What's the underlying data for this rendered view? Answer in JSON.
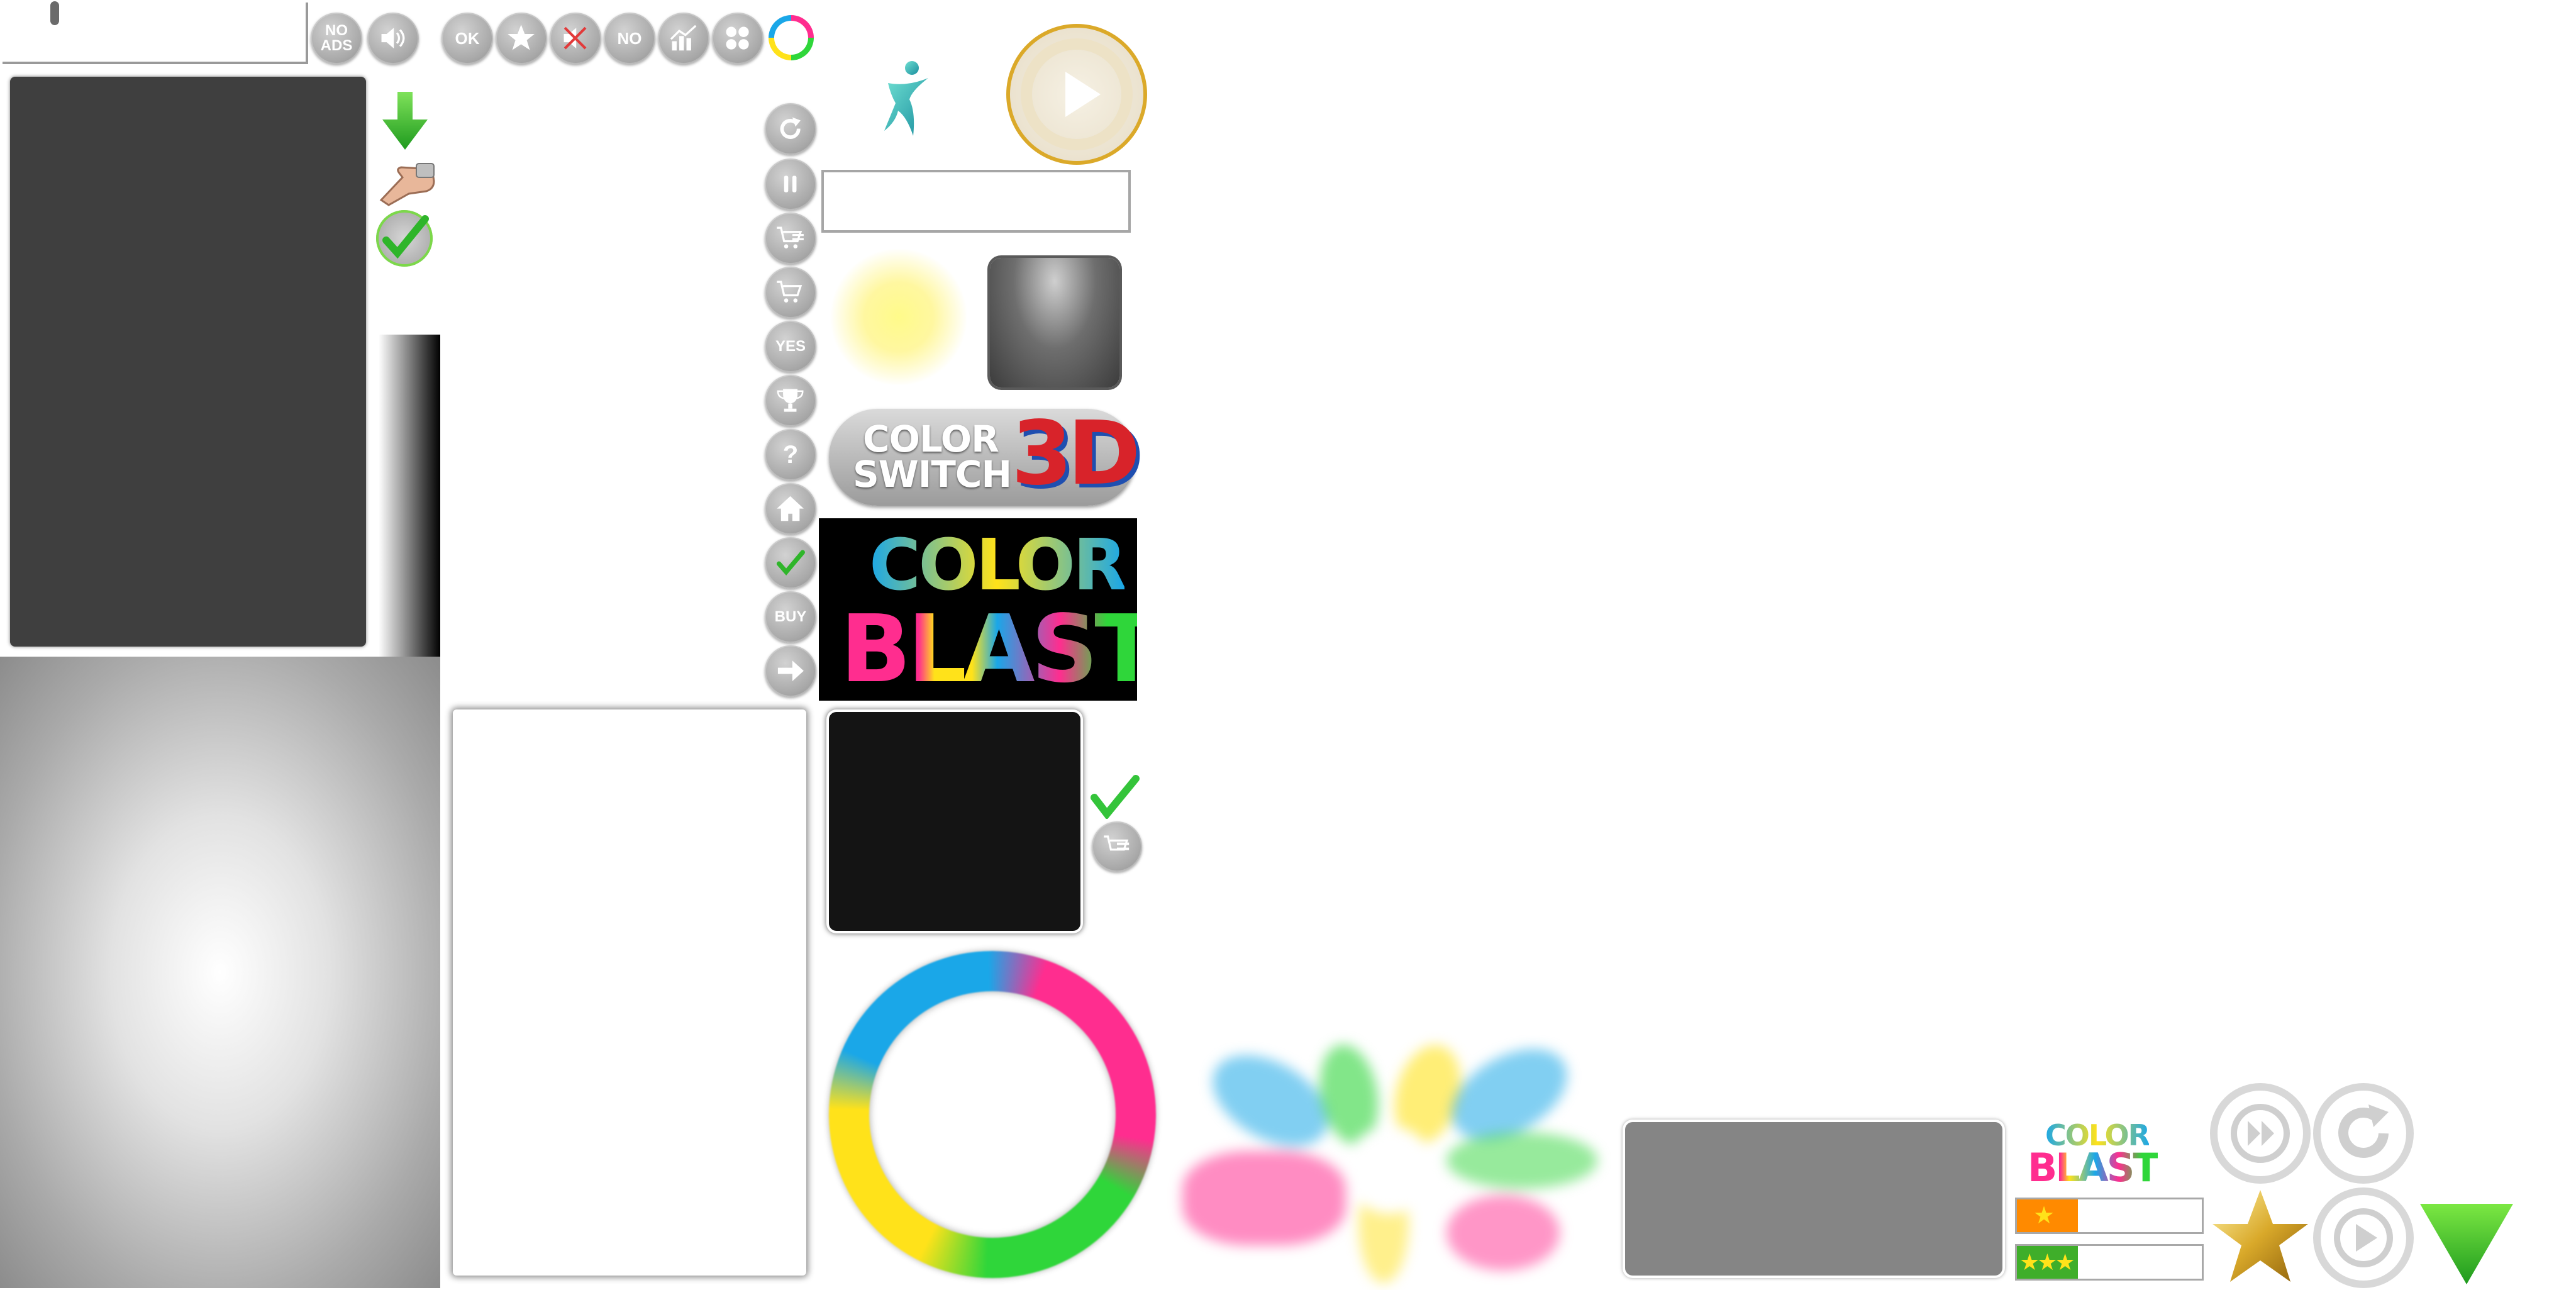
{
  "buttons": {
    "no_ads": "NO\nADS",
    "ok": "OK",
    "no": "NO",
    "yes": "YES",
    "buy": "BUY",
    "help": "?"
  },
  "logos": {
    "switch_line1": "COLOR",
    "switch_line2": "SWITCH",
    "switch_3d": "3D",
    "blast_word1": "COLOR",
    "blast_word2": "BLAST",
    "small_word1": "COLOR",
    "small_word2": "BLAST"
  },
  "colors": {
    "cyan": "#1aa7e8",
    "magenta": "#ff2d8f",
    "yellow": "#ffe21a",
    "green": "#2fd63a",
    "gold": "#d9a92a",
    "orange": "#ff8a00"
  },
  "ratings": {
    "bar1_stars": 1,
    "bar2_stars": 3,
    "max_stars": 3
  },
  "icons": [
    "speaker-icon",
    "star-icon",
    "no-sound-icon",
    "chart-icon",
    "grid-icon",
    "color-ring-icon",
    "restart-icon",
    "pause-icon",
    "cart-list-icon",
    "cart-icon",
    "trophy-icon",
    "home-icon",
    "check-icon",
    "arrow-right-icon",
    "fast-forward-icon",
    "play-icon",
    "down-arrow-icon",
    "hand-pointer-icon"
  ]
}
